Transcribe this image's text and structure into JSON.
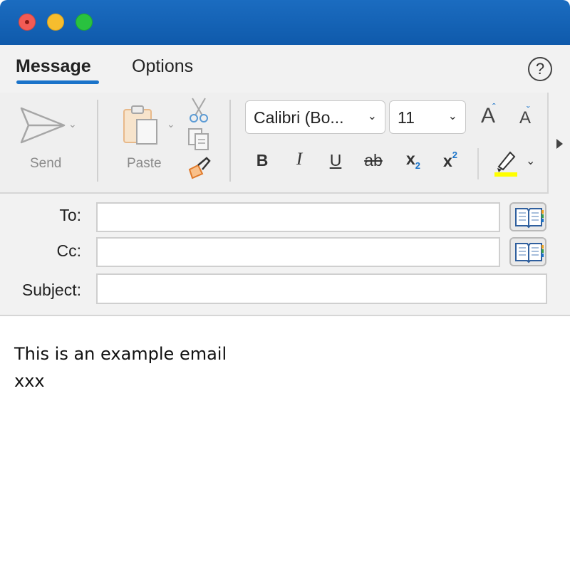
{
  "tabs": [
    {
      "label": "Message",
      "active": true
    },
    {
      "label": "Options",
      "active": false
    }
  ],
  "help": {
    "label": "?"
  },
  "send_group": {
    "label": "Send",
    "icon": "send-icon"
  },
  "paste_group": {
    "label": "Paste",
    "icon": "paste-icon"
  },
  "font": {
    "family_value": "Calibri (Bo...",
    "size_value": "11"
  },
  "format": {
    "grow_font": "A",
    "shrink_font": "A",
    "bold": "B",
    "italic": "I",
    "underline": "U",
    "strikethrough": "ab",
    "subscript_base": "x",
    "subscript_mark": "2",
    "superscript_base": "x",
    "superscript_mark": "2"
  },
  "fields": {
    "to_label": "To:",
    "cc_label": "Cc:",
    "subject_label": "Subject:",
    "to_value": "",
    "cc_value": "",
    "subject_value": ""
  },
  "body": {
    "lines": [
      "This is an example email",
      "xxx"
    ]
  },
  "colors": {
    "titlebar": "#1565b8",
    "accent": "#1a73c9",
    "highlight": "#ffff00",
    "ribbon_bg": "#f2f2f2"
  }
}
